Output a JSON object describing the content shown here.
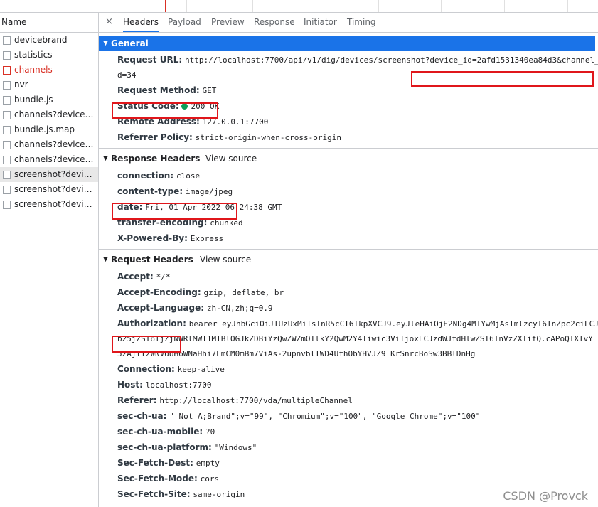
{
  "network_list": {
    "column_header": "Name",
    "items": [
      {
        "name": "devicebrand",
        "state": "normal"
      },
      {
        "name": "statistics",
        "state": "normal"
      },
      {
        "name": "channels",
        "state": "error"
      },
      {
        "name": "nvr",
        "state": "normal"
      },
      {
        "name": "bundle.js",
        "state": "normal"
      },
      {
        "name": "channels?device_id...",
        "state": "normal"
      },
      {
        "name": "bundle.js.map",
        "state": "normal"
      },
      {
        "name": "channels?device_id...",
        "state": "normal"
      },
      {
        "name": "channels?device_id...",
        "state": "normal"
      },
      {
        "name": "screenshot?device_...",
        "state": "selected"
      },
      {
        "name": "screenshot?device_...",
        "state": "normal"
      },
      {
        "name": "screenshot?device_...",
        "state": "normal"
      }
    ]
  },
  "tabs": [
    "Headers",
    "Payload",
    "Preview",
    "Response",
    "Initiator",
    "Timing"
  ],
  "close_glyph": "×",
  "general": {
    "title": "General",
    "request_url_key": "Request URL:",
    "request_url_value_line1": "http://localhost:7700/api/v1/dig/devices/screenshot?device_id=2afd1531340ea84d3&channel_i",
    "request_url_value_line2": "d=34",
    "request_method_key": "Request Method:",
    "request_method_value": "GET",
    "status_code_key": "Status Code:",
    "status_code_value": "200 OK",
    "status_color": "#0f9d58",
    "remote_address_key": "Remote Address:",
    "remote_address_value": "127.0.0.1:7700",
    "referrer_policy_key": "Referrer Policy:",
    "referrer_policy_value": "strict-origin-when-cross-origin"
  },
  "response_headers": {
    "title": "Response Headers",
    "view_source": "View source",
    "rows": [
      {
        "k": "connection:",
        "v": "close"
      },
      {
        "k": "content-type:",
        "v": "image/jpeg"
      },
      {
        "k": "date:",
        "v": "Fri, 01 Apr 2022 06:24:38 GMT"
      },
      {
        "k": "transfer-encoding:",
        "v": "chunked"
      },
      {
        "k": "X-Powered-By:",
        "v": "Express"
      }
    ]
  },
  "request_headers": {
    "title": "Request Headers",
    "view_source": "View source",
    "accept_k": "Accept:",
    "accept_v": "*/*",
    "accept_encoding_k": "Accept-Encoding:",
    "accept_encoding_v": "gzip, deflate, br",
    "accept_language_k": "Accept-Language:",
    "accept_language_v": "zh-CN,zh;q=0.9",
    "authorization_k": "Authorization:",
    "authorization_v1": "bearer eyJhbGciOiJIUzUxMiIsInR5cCI6IkpXVCJ9.eyJleHAiOjE2NDg4MTYwMjAsImlzcyI6InZpc2ciLCJu",
    "authorization_v2": "b25jZSI6IjZjNWRlMWI1MTBlOGJkZDBiYzQwZWZmOTlkY2QwM2Y4Iiwic3ViIjoxLCJzdWJfdHlwZSI6InVzZXIifQ.cAPoQIXIvY",
    "authorization_v3": "52AjlI2WNVdUH6WNaHhi7LmCM0mBm7ViAs-2upnvblIWD4UfhObYHVJZ9_KrSnrcBoSw3BBlDnHg",
    "connection_k": "Connection:",
    "connection_v": "keep-alive",
    "host_k": "Host:",
    "host_v": "localhost:7700",
    "referer_k": "Referer:",
    "referer_v": "http://localhost:7700/vda/multipleChannel",
    "sec_ch_ua_k": "sec-ch-ua:",
    "sec_ch_ua_v": "\" Not A;Brand\";v=\"99\", \"Chromium\";v=\"100\", \"Google Chrome\";v=\"100\"",
    "sec_ch_ua_mobile_k": "sec-ch-ua-mobile:",
    "sec_ch_ua_mobile_v": "?0",
    "sec_ch_ua_platform_k": "sec-ch-ua-platform:",
    "sec_ch_ua_platform_v": "\"Windows\"",
    "sec_fetch_dest_k": "Sec-Fetch-Dest:",
    "sec_fetch_dest_v": "empty",
    "sec_fetch_mode_k": "Sec-Fetch-Mode:",
    "sec_fetch_mode_v": "cors",
    "sec_fetch_site_k": "Sec-Fetch-Site:",
    "sec_fetch_site_v": "same-origin"
  },
  "watermark": "CSDN @Provck",
  "highlight_color": "#e0161b",
  "accent_color": "#1a73e8"
}
